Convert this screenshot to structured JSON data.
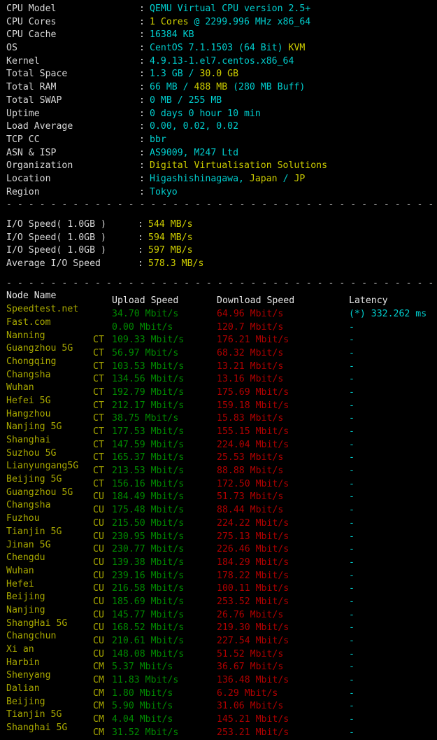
{
  "theme": {
    "background": "#000000",
    "label_color": "#d6d6d6",
    "cyan": "#00cdcd",
    "yellow": "#cdcd00",
    "olive": "#a8a800",
    "green": "#008a00",
    "red": "#b00000"
  },
  "system_info": {
    "rows": [
      {
        "label": "CPU Model",
        "value_cyan": "QEMU Virtual CPU version 2.5+",
        "value_yellow": "",
        "value_tail": ""
      },
      {
        "label": "CPU Cores",
        "value_cyan": "",
        "value_yellow": "1 Cores",
        "value_tail": " @ 2299.996 MHz x86_64"
      },
      {
        "label": "CPU Cache",
        "value_cyan": "16384 KB",
        "value_yellow": "",
        "value_tail": ""
      },
      {
        "label": "OS",
        "value_cyan": "CentOS 7.1.1503 (64 Bit) ",
        "value_yellow": "KVM",
        "value_tail": ""
      },
      {
        "label": "Kernel",
        "value_cyan": "4.9.13-1.el7.centos.x86_64",
        "value_yellow": "",
        "value_tail": ""
      },
      {
        "label": "Total Space",
        "value_cyan": "1.3 GB / ",
        "value_yellow": "30.0 GB",
        "value_tail": ""
      },
      {
        "label": "Total RAM",
        "value_cyan": "66 MB / ",
        "value_yellow": "488 MB",
        "value_tail": " (280 MB Buff)"
      },
      {
        "label": "Total SWAP",
        "value_cyan": "0 MB / 255 MB",
        "value_yellow": "",
        "value_tail": ""
      },
      {
        "label": "Uptime",
        "value_cyan": "0 days 0 hour 10 min",
        "value_yellow": "",
        "value_tail": ""
      },
      {
        "label": "Load Average",
        "value_cyan": "0.00, 0.02, 0.02",
        "value_yellow": "",
        "value_tail": ""
      },
      {
        "label": "TCP CC",
        "value_cyan": "bbr",
        "value_yellow": "",
        "value_tail": ""
      },
      {
        "label": "ASN & ISP",
        "value_cyan": "AS9009, M247 Ltd",
        "value_yellow": "",
        "value_tail": ""
      },
      {
        "label": "Organization",
        "value_cyan": "",
        "value_yellow": "Digital Virtualisation Solutions",
        "value_tail": ""
      },
      {
        "label": "Location",
        "value_cyan": "Higashishinagawa, ",
        "value_yellow": "Japan",
        "value_tail": " / ",
        "value_yellow2": "JP"
      },
      {
        "label": "Region",
        "value_cyan": "Tokyo",
        "value_yellow": "",
        "value_tail": ""
      }
    ],
    "separator": ":"
  },
  "divider": "----------------------------------------------------------------------",
  "io_test": {
    "rows": [
      {
        "label": "I/O Speed( 1.0GB )",
        "value": "544 MB/s"
      },
      {
        "label": "I/O Speed( 1.0GB )",
        "value": "594 MB/s"
      },
      {
        "label": "I/O Speed( 1.0GB )",
        "value": "597 MB/s"
      },
      {
        "label": "Average I/O Speed",
        "value": "578.3 MB/s"
      }
    ],
    "separator": ":"
  },
  "speedtest": {
    "headers": {
      "node": "Node Name",
      "upload": "Upload Speed",
      "download": "Download Speed",
      "latency": "Latency"
    },
    "rows": [
      {
        "node": "Speedtest.net",
        "isp": "",
        "upload": "34.70 Mbit/s",
        "download": "64.96 Mbit/s",
        "latency": "(*) 332.262 ms"
      },
      {
        "node": "Fast.com",
        "isp": "",
        "upload": "0.00 Mbit/s",
        "download": "120.7 Mbit/s",
        "latency": "-"
      },
      {
        "node": "Nanning",
        "isp": "CT",
        "upload": "109.33 Mbit/s",
        "download": "176.21 Mbit/s",
        "latency": "-"
      },
      {
        "node": "Guangzhou 5G",
        "isp": "CT",
        "upload": "56.97 Mbit/s",
        "download": "68.32 Mbit/s",
        "latency": "-"
      },
      {
        "node": "Chongqing",
        "isp": "CT",
        "upload": "103.53 Mbit/s",
        "download": "13.21 Mbit/s",
        "latency": "-"
      },
      {
        "node": "Changsha",
        "isp": "CT",
        "upload": "134.56 Mbit/s",
        "download": "13.16 Mbit/s",
        "latency": "-"
      },
      {
        "node": "Wuhan",
        "isp": "CT",
        "upload": "192.79 Mbit/s",
        "download": "175.69 Mbit/s",
        "latency": "-"
      },
      {
        "node": "Hefei 5G",
        "isp": "CT",
        "upload": "212.17 Mbit/s",
        "download": "159.18 Mbit/s",
        "latency": "-"
      },
      {
        "node": "Hangzhou",
        "isp": "CT",
        "upload": "38.75 Mbit/s",
        "download": "15.83 Mbit/s",
        "latency": "-"
      },
      {
        "node": "Nanjing 5G",
        "isp": "CT",
        "upload": "177.53 Mbit/s",
        "download": "155.15 Mbit/s",
        "latency": "-"
      },
      {
        "node": "Shanghai",
        "isp": "CT",
        "upload": "147.59 Mbit/s",
        "download": "224.04 Mbit/s",
        "latency": "-"
      },
      {
        "node": "Suzhou 5G",
        "isp": "CT",
        "upload": "165.37 Mbit/s",
        "download": "25.53 Mbit/s",
        "latency": "-"
      },
      {
        "node": "Lianyungang5G",
        "isp": "CT",
        "upload": "213.53 Mbit/s",
        "download": "88.88 Mbit/s",
        "latency": "-"
      },
      {
        "node": "Beijing 5G",
        "isp": "CT",
        "upload": "156.16 Mbit/s",
        "download": "172.50 Mbit/s",
        "latency": "-"
      },
      {
        "node": "Guangzhou 5G",
        "isp": "CU",
        "upload": "184.49 Mbit/s",
        "download": "51.73 Mbit/s",
        "latency": "-"
      },
      {
        "node": "Changsha",
        "isp": "CU",
        "upload": "175.48 Mbit/s",
        "download": "88.44 Mbit/s",
        "latency": "-"
      },
      {
        "node": "Fuzhou",
        "isp": "CU",
        "upload": "215.50 Mbit/s",
        "download": "224.22 Mbit/s",
        "latency": "-"
      },
      {
        "node": "Tianjin 5G",
        "isp": "CU",
        "upload": "230.95 Mbit/s",
        "download": "275.13 Mbit/s",
        "latency": "-"
      },
      {
        "node": "Jinan 5G",
        "isp": "CU",
        "upload": "230.77 Mbit/s",
        "download": "226.46 Mbit/s",
        "latency": "-"
      },
      {
        "node": "Chengdu",
        "isp": "CU",
        "upload": "139.38 Mbit/s",
        "download": "184.29 Mbit/s",
        "latency": "-"
      },
      {
        "node": "Wuhan",
        "isp": "CU",
        "upload": "239.16 Mbit/s",
        "download": "178.22 Mbit/s",
        "latency": "-"
      },
      {
        "node": "Hefei",
        "isp": "CU",
        "upload": "216.58 Mbit/s",
        "download": "100.11 Mbit/s",
        "latency": "-"
      },
      {
        "node": "Beijing",
        "isp": "CU",
        "upload": "185.69 Mbit/s",
        "download": "253.52 Mbit/s",
        "latency": "-"
      },
      {
        "node": "Nanjing",
        "isp": "CU",
        "upload": "145.77 Mbit/s",
        "download": "26.76 Mbit/s",
        "latency": "-"
      },
      {
        "node": "ShangHai 5G",
        "isp": "CU",
        "upload": "168.52 Mbit/s",
        "download": "219.30 Mbit/s",
        "latency": "-"
      },
      {
        "node": "Changchun",
        "isp": "CU",
        "upload": "210.61 Mbit/s",
        "download": "227.54 Mbit/s",
        "latency": "-"
      },
      {
        "node": "Xi an",
        "isp": "CU",
        "upload": "148.08 Mbit/s",
        "download": "51.52 Mbit/s",
        "latency": "-"
      },
      {
        "node": "Harbin",
        "isp": "CM",
        "upload": "5.37 Mbit/s",
        "download": "36.67 Mbit/s",
        "latency": "-"
      },
      {
        "node": "Shenyang",
        "isp": "CM",
        "upload": "11.83 Mbit/s",
        "download": "136.48 Mbit/s",
        "latency": "-"
      },
      {
        "node": "Dalian",
        "isp": "CM",
        "upload": "1.80 Mbit/s",
        "download": "6.29 Mbit/s",
        "latency": "-"
      },
      {
        "node": "Beijing",
        "isp": "CM",
        "upload": "5.90 Mbit/s",
        "download": "31.06 Mbit/s",
        "latency": "-"
      },
      {
        "node": "Tianjin 5G",
        "isp": "CM",
        "upload": "4.04 Mbit/s",
        "download": "145.21 Mbit/s",
        "latency": "-"
      },
      {
        "node": "Shanghai 5G",
        "isp": "CM",
        "upload": "31.52 Mbit/s",
        "download": "253.21 Mbit/s",
        "latency": "-"
      }
    ]
  }
}
